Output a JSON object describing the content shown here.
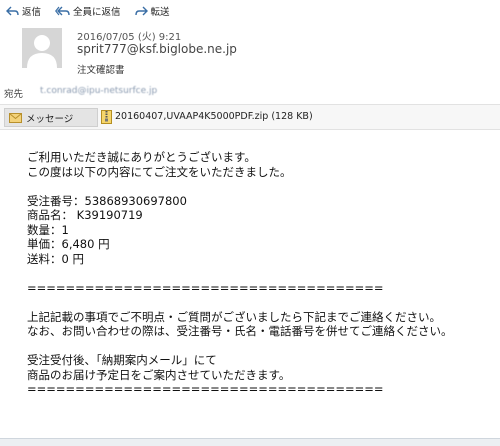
{
  "toolbar": {
    "reply_label": "返信",
    "reply_all_label": "全員に返信",
    "forward_label": "転送"
  },
  "header": {
    "date": "2016/07/05 (火) 9:21",
    "sender": "sprit777@ksf.biglobe.ne.jp",
    "subject": "注文確認書",
    "to_label": "宛先",
    "to_value": "t.conrad@ipu-netsurfce.jp"
  },
  "attachments": {
    "message_tab_label": "メッセージ",
    "file_label": "20160407,UVAAP4K5000PDF.zip (128 KB)"
  },
  "body": {
    "lines": [
      "ご利用いただき誠にありがとうございます。",
      "この度は以下の内容にてご注文をいただきました。",
      "",
      "受注番号：53868930697800",
      "商品名： K39190719",
      "数量：1",
      "単価：6,480 円",
      "送料：0 円",
      "",
      "=====================================",
      "",
      "上記記載の事項でご不明点・ご質問がございましたら下記までご連絡ください。",
      "なお、お問い合わせの際は、受注番号・氏名・電話番号を併せてご連絡ください。",
      "",
      "受注受付後、「納期案内メール」にて",
      "商品のお届け予定日をご案内させていただきます。",
      "====================================="
    ]
  },
  "colors": {
    "attach_bar_bg": "#f7f7f7",
    "avatar_bg": "#cfcfcf"
  }
}
